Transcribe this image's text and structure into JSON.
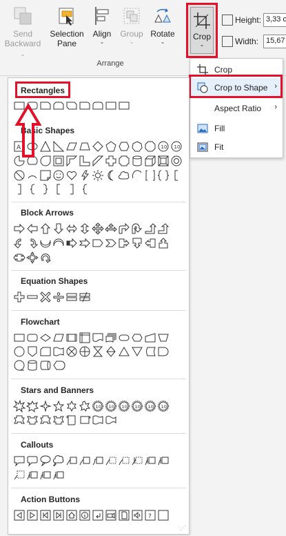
{
  "ribbon": {
    "send_backward": {
      "line1": "Send",
      "line2": "Backward"
    },
    "selection_pane": {
      "line1": "Selection",
      "line2": "Pane"
    },
    "align": "Align",
    "group": "Group",
    "rotate": "Rotate",
    "crop": "Crop",
    "arrange_label": "Arrange",
    "height_label": "Height:",
    "height_value": "3,33 c",
    "width_label": "Width:",
    "width_value": "15,67"
  },
  "crop_menu": {
    "crop": "Crop",
    "crop_to_shape": "Crop to Shape",
    "aspect_ratio": "Aspect Ratio",
    "fill": "Fill",
    "fit": "Fit"
  },
  "shapes_panel": {
    "categories": {
      "rectangles": "Rectangles",
      "basic_shapes": "Basic Shapes",
      "block_arrows": "Block Arrows",
      "equation_shapes": "Equation Shapes",
      "flowchart": "Flowchart",
      "stars_banners": "Stars and Banners",
      "callouts": "Callouts",
      "action_buttons": "Action Buttons"
    }
  },
  "colors": {
    "highlight": "#e3102a",
    "menu_hover": "#e5f0fb",
    "accent_blue": "#2b6cc4"
  },
  "icons": {
    "send_backward": "send-backward-icon",
    "selection_pane": "selection-pane-icon",
    "align": "align-icon",
    "group": "group-icon",
    "rotate": "rotate-icon",
    "crop": "crop-icon"
  }
}
